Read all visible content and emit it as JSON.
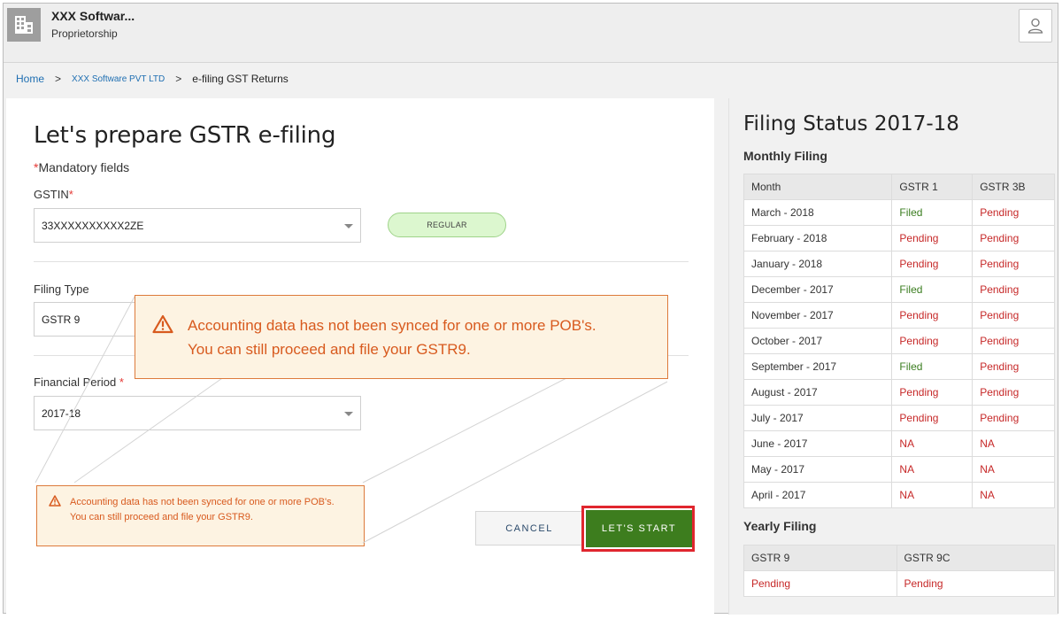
{
  "header": {
    "org_name": "XXX Softwar...",
    "org_type": "Proprietorship"
  },
  "breadcrumb": {
    "home": "Home",
    "sep": ">",
    "company": "XXX Software PVT LTD",
    "current": "e-filing GST Returns"
  },
  "form": {
    "title": "Let's prepare GSTR e-filing",
    "mandatory_star": "*",
    "mandatory_text": "Mandatory fields",
    "gstin_label": "GSTIN",
    "gstin_value": "33XXXXXXXXXX2ZE",
    "gstin_badge": "REGULAR",
    "filing_type_label": "Filing Type",
    "filing_type_value": "GSTR 9",
    "financial_period_label": "Financial Period",
    "financial_period_value": "2017-18",
    "required_star": "*"
  },
  "warning": {
    "line1": "Accounting data has not been synced for one or more POB's.",
    "line2": "You can still proceed and file your GSTR9."
  },
  "buttons": {
    "cancel": "CANCEL",
    "start": "LET'S START"
  },
  "status": {
    "title": "Filing Status 2017-18",
    "monthly_heading": "Monthly Filing",
    "monthly_columns": [
      "Month",
      "GSTR 1",
      "GSTR 3B"
    ],
    "monthly_rows": [
      {
        "month": "March - 2018",
        "gstr1": "Filed",
        "gstr3b": "Pending"
      },
      {
        "month": "February - 2018",
        "gstr1": "Pending",
        "gstr3b": "Pending"
      },
      {
        "month": "January - 2018",
        "gstr1": "Pending",
        "gstr3b": "Pending"
      },
      {
        "month": "December - 2017",
        "gstr1": "Filed",
        "gstr3b": "Pending"
      },
      {
        "month": "November - 2017",
        "gstr1": "Pending",
        "gstr3b": "Pending"
      },
      {
        "month": "October - 2017",
        "gstr1": "Pending",
        "gstr3b": "Pending"
      },
      {
        "month": "September - 2017",
        "gstr1": "Filed",
        "gstr3b": "Pending"
      },
      {
        "month": "August - 2017",
        "gstr1": "Pending",
        "gstr3b": "Pending"
      },
      {
        "month": "July - 2017",
        "gstr1": "Pending",
        "gstr3b": "Pending"
      },
      {
        "month": "June - 2017",
        "gstr1": "NA",
        "gstr3b": "NA"
      },
      {
        "month": "May - 2017",
        "gstr1": "NA",
        "gstr3b": "NA"
      },
      {
        "month": "April - 2017",
        "gstr1": "NA",
        "gstr3b": "NA"
      }
    ],
    "yearly_heading": "Yearly Filing",
    "yearly_columns": [
      "GSTR 9",
      "GSTR 9C"
    ],
    "yearly_values": [
      "Pending",
      "Pending"
    ]
  },
  "colors": {
    "filed": "#3a7d1f",
    "pending": "#c62828",
    "accent_green": "#3d7d1e",
    "warning_text": "#d85a1e",
    "highlight_red": "#e0262e"
  }
}
